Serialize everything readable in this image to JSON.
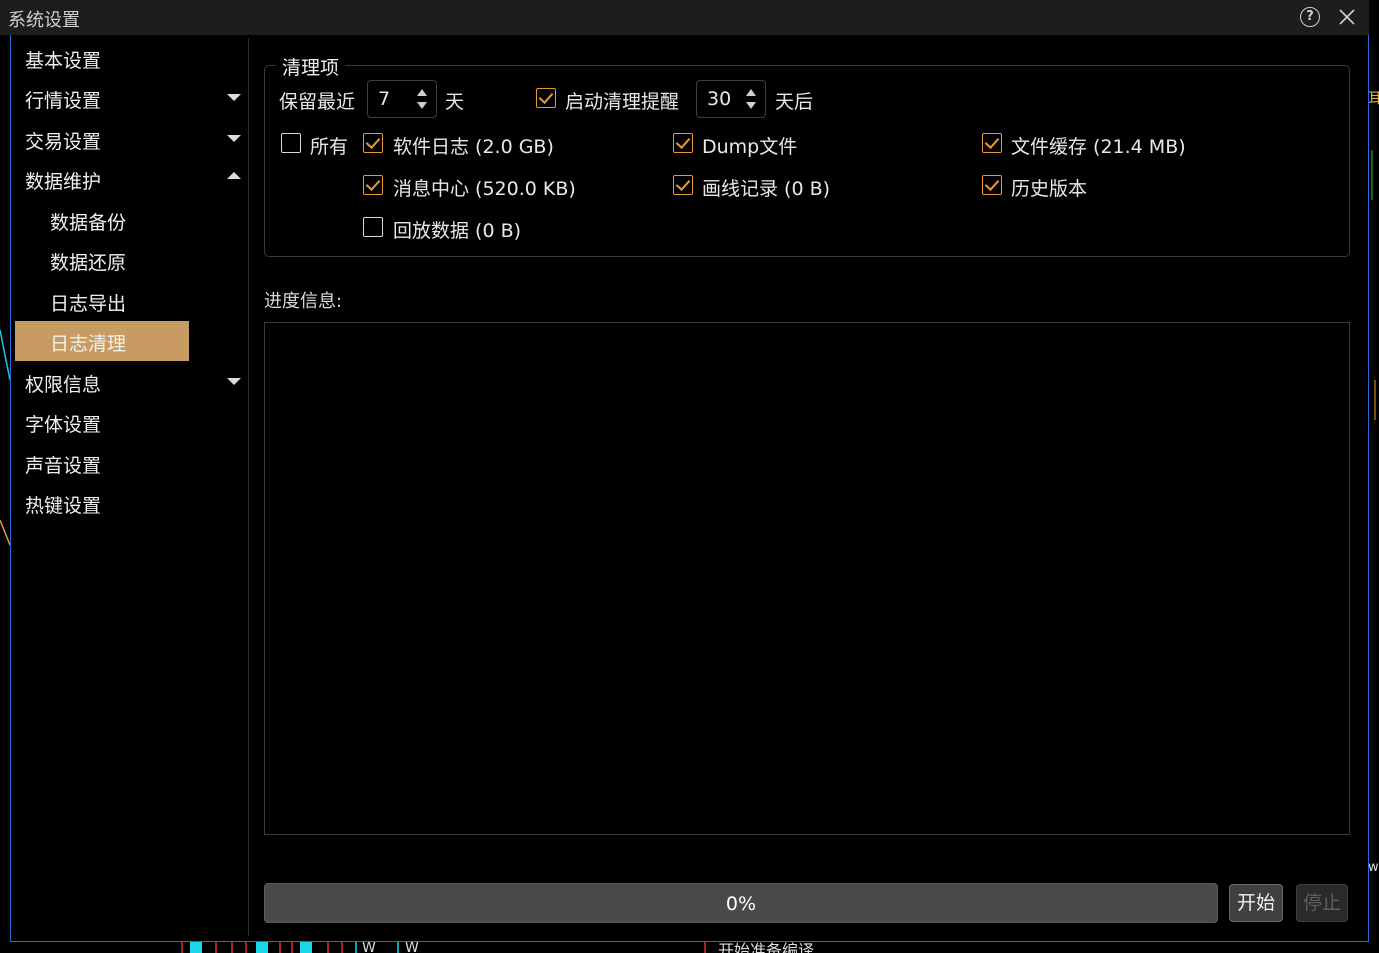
{
  "window": {
    "title": "系统设置"
  },
  "sidebar": {
    "items": [
      {
        "label": "基本设置",
        "level": 0
      },
      {
        "label": "行情设置",
        "level": 0,
        "expander": "collapsed"
      },
      {
        "label": "交易设置",
        "level": 0,
        "expander": "collapsed"
      },
      {
        "label": "数据维护",
        "level": 0,
        "expander": "expanded"
      },
      {
        "label": "数据备份",
        "level": 1
      },
      {
        "label": "数据还原",
        "level": 1
      },
      {
        "label": "日志导出",
        "level": 1
      },
      {
        "label": "日志清理",
        "level": 1,
        "selected": true
      },
      {
        "label": "权限信息",
        "level": 0,
        "expander": "collapsed"
      },
      {
        "label": "字体设置",
        "level": 0
      },
      {
        "label": "声音设置",
        "level": 0
      },
      {
        "label": "热键设置",
        "level": 0
      }
    ]
  },
  "cleanup": {
    "group_title": "清理项",
    "keep_label": "保留最近",
    "keep_days": "7",
    "days_unit": "天",
    "reminder": {
      "label": "启动清理提醒",
      "checked": true
    },
    "reminder_days": "30",
    "reminder_unit": "天后",
    "options": {
      "all": {
        "label": "所有",
        "checked": false
      },
      "software_log": {
        "label": "软件日志 (2.0 GB)",
        "checked": true
      },
      "dump_files": {
        "label": "Dump文件",
        "checked": true
      },
      "file_cache": {
        "label": "文件缓存 (21.4 MB)",
        "checked": true
      },
      "message_center": {
        "label": "消息中心 (520.0 KB)",
        "checked": true
      },
      "drawing_records": {
        "label": "画线记录 (0 B)",
        "checked": true
      },
      "history_versions": {
        "label": "历史版本",
        "checked": true
      },
      "playback_data": {
        "label": "回放数据 (0 B)",
        "checked": false
      }
    }
  },
  "progress": {
    "label": "进度信息:",
    "log_text": "",
    "percent_text": "0%",
    "value": 0
  },
  "buttons": {
    "start": "开始",
    "stop": "停止"
  },
  "background": {
    "right_glyph_1": "耳",
    "right_glyph_2": "w",
    "bottom_w1": "W",
    "bottom_w2": "W",
    "bottom_status": "开始准备编译..."
  },
  "colors": {
    "accent": "#c79b61",
    "checkbox_check": "#e89a2e",
    "window_border": "#2a6ad8",
    "titlebar_bg": "#1d1d1d"
  }
}
